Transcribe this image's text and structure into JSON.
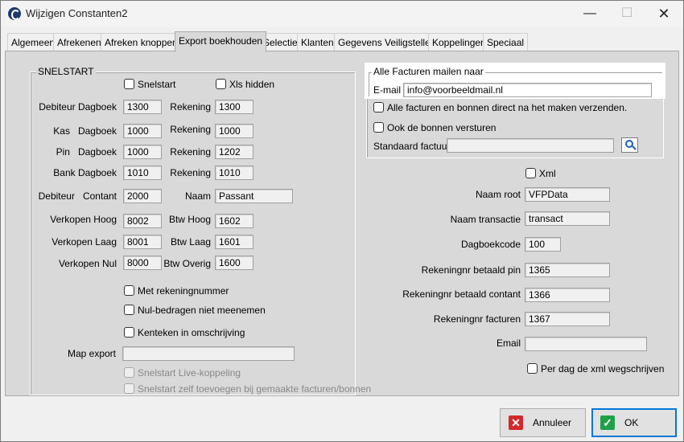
{
  "window": {
    "title": "Wijzigen Constanten2",
    "minimize": "—",
    "maximize": "☐",
    "close": "✕"
  },
  "tabs": [
    {
      "label": "Algemeen"
    },
    {
      "label": "Afrekenen"
    },
    {
      "label": "Afreken knoppen"
    },
    {
      "label": "Export boekhouden"
    },
    {
      "label": "Selectie"
    },
    {
      "label": "Klanten"
    },
    {
      "label": "Gegevens Veiligstellen"
    },
    {
      "label": "Koppelingen"
    },
    {
      "label": "Speciaal"
    }
  ],
  "snelstart": {
    "title": "SNELSTART",
    "cb_snelstart": "Snelstart",
    "cb_xls_hidden": "Xls hidden",
    "rows": [
      {
        "label": "Debiteur Dagboek",
        "value": "1300",
        "label2": "Rekening",
        "value2": "1300"
      },
      {
        "label": "Kas   Dagboek",
        "value": "1000",
        "label2": "Rekening",
        "value2": "1000"
      },
      {
        "label": "Pin   Dagboek",
        "value": "1000",
        "label2": "Rekening",
        "value2": "1202"
      },
      {
        "label": "Bank Dagboek",
        "value": "1010",
        "label2": "Rekening",
        "value2": "1010"
      },
      {
        "label": "Debiteur   Contant",
        "value": "2000",
        "label2": "Naam",
        "value2": "Passant"
      },
      {
        "label": "Verkopen Hoog",
        "value": "8002",
        "label2": "Btw Hoog",
        "value2": "1602"
      },
      {
        "label": "Verkopen Laag",
        "value": "8001",
        "label2": "Btw Laag",
        "value2": "1601"
      },
      {
        "label": "Verkopen Nul",
        "value": "8000",
        "label2": "Btw Overig",
        "value2": "1600"
      }
    ],
    "cb_met_rekeningnummer": "Met rekeningnummer",
    "cb_nul_bedragen": "Nul-bedragen niet meenemen",
    "cb_kenteken": "Kenteken in omschrijving",
    "map_export_label": "Map export",
    "map_export_value": "",
    "cb_live_koppeling": "Snelstart Live-koppeling",
    "cb_zelf_toevoegen": "Snelstart zelf toevoegen bij gemaakte facturen/bonnen"
  },
  "mail": {
    "title": "Alle Facturen mailen naar",
    "email_label": "E-mail",
    "email_value": "info@voorbeeldmail.nl",
    "cb_direct": "Alle facturen en bonnen direct na het maken verzenden.",
    "cb_bonnen": "Ook de bonnen versturen",
    "standaard_factuur_label": "Standaard factuur",
    "standaard_factuur_value": ""
  },
  "xml": {
    "cb_xml": "Xml",
    "rows": [
      {
        "label": "Naam root",
        "value": "VFPData"
      },
      {
        "label": "Naam transactie",
        "value": "transact"
      },
      {
        "label": "Dagboekcode",
        "value": "100"
      },
      {
        "label": "Rekeningnr betaald pin",
        "value": "1365"
      },
      {
        "label": "Rekeningnr betaald contant",
        "value": "1366"
      },
      {
        "label": "Rekeningnr facturen",
        "value": "1367"
      },
      {
        "label": "Email",
        "value": ""
      }
    ],
    "cb_per_dag": "Per dag de xml wegschrijven"
  },
  "buttons": {
    "annuleer": "Annuleer",
    "ok": "OK"
  }
}
